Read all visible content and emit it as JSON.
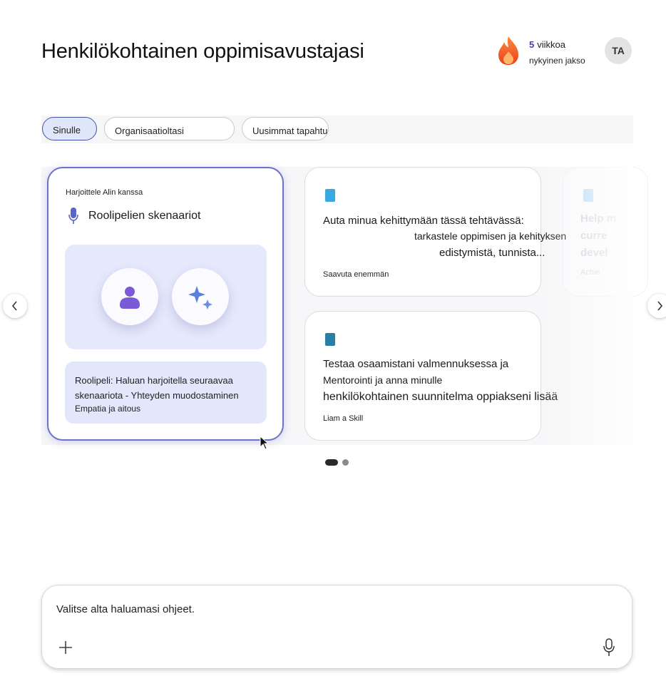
{
  "header": {
    "title": "Henkilökohtainen oppimisavustajasi",
    "streak_number": "5",
    "streak_unit": "viikkoa",
    "streak_label": "nykyinen jakso",
    "avatar_initials": "TA"
  },
  "tabs": [
    {
      "label": "Sinulle",
      "active": true
    },
    {
      "label": "Organisaatioltasi",
      "active": false
    },
    {
      "label": "Uusimmat tapahtumat",
      "active": false
    }
  ],
  "cards": {
    "roleplay": {
      "eyebrow": "Harjoittele Alin kanssa",
      "heading": "Roolipelien skenaariot",
      "prompt_line1": "Roolipeli: Haluan harjoitella seuraavaa skenaariota - Yhteyden muodostaminen",
      "prompt_line2": "Empatia ja aitous"
    },
    "progress": {
      "line1": "Auta minua kehittymään tässä tehtävässä:",
      "line2": "tarkastele oppimisen ja kehityksen",
      "line3": "edistymistä, tunnista...",
      "footer": "Saavuta enemmän"
    },
    "mentoring": {
      "line1": "Testaa osaamistani valmennuksessa ja",
      "line2": "Mentorointi ja anna minulle",
      "line3": "henkilökohtainen suunnitelma oppiakseni lisää",
      "footer": "Liam a Skill"
    },
    "partial": {
      "line1": "Help m",
      "line2": "curre",
      "line3": "devel",
      "footer": "Achie"
    }
  },
  "carousel": {
    "page": 1,
    "pages": 2
  },
  "composer": {
    "placeholder": "Valitse alta haluamasi ohjeet."
  },
  "colors": {
    "accent": "#4452a6",
    "hero_bg": "#e6e8fb",
    "flame": "#f25a22"
  }
}
